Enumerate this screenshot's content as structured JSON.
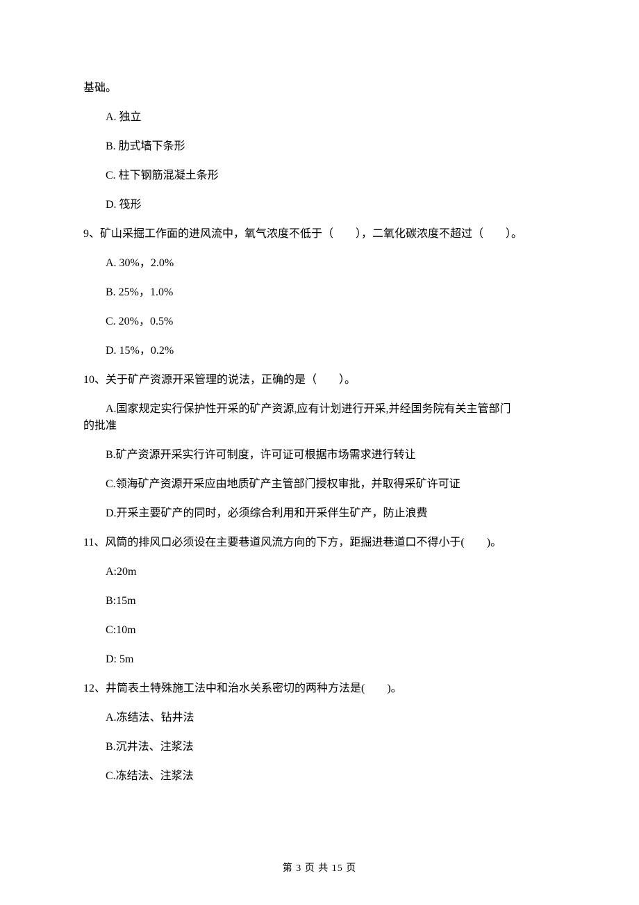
{
  "topFragment": "基础。",
  "q8": {
    "A": "A. 独立",
    "B": "B. 肋式墙下条形",
    "C": "C. 柱下钢筋混凝土条形",
    "D": "D. 筏形"
  },
  "q9": {
    "stem": "9、矿山采掘工作面的进风流中，氧气浓度不低于（　　），二氧化碳浓度不超过（　　）。",
    "A": "A. 30%，2.0%",
    "B": "B. 25%，1.0%",
    "C": "C. 20%，0.5%",
    "D": "D. 15%，0.2%"
  },
  "q10": {
    "stem": "10、关于矿产资源开采管理的说法，正确的是（　　）。",
    "A_line1": "A.国家规定实行保护性开采的矿产资源,应有计划进行开采,并经国务院有关主管部门",
    "A_line2": "的批准",
    "B": "B.矿产资源开采实行许可制度，许可证可根据市场需求进行转让",
    "C": "C.领海矿产资源开采应由地质矿产主管部门授权审批，并取得采矿许可证",
    "D": "D.开采主要矿产的同时，必须综合利用和开采伴生矿产，防止浪费"
  },
  "q11": {
    "stem": "11、风筒的排风口必须设在主要巷道风流方向的下方，距掘进巷道口不得小于(　　)。",
    "A": "A:20m",
    "B": "B:15m",
    "C": "C:10m",
    "D": "D: 5m"
  },
  "q12": {
    "stem": "12、井筒表土特殊施工法中和治水关系密切的两种方法是(　　)。",
    "A": "A.冻结法、钻井法",
    "B": "B.沉井法、注浆法",
    "C": "C.冻结法、注浆法"
  },
  "footer": "第 3 页 共 15 页"
}
